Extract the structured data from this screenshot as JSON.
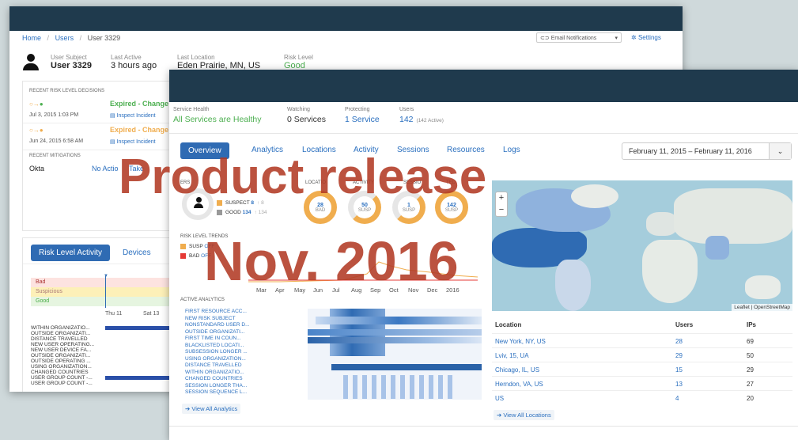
{
  "back": {
    "breadcrumb": [
      "Home",
      "/",
      "Users",
      "/",
      "User 3329"
    ],
    "email_notifications": "Email Notifications",
    "settings": "Settings",
    "summary": [
      {
        "label": "User Subject",
        "value": "User 3329"
      },
      {
        "label": "Last Active",
        "value": "3 hours ago"
      },
      {
        "label": "Last Location",
        "value": "Eden Prairie, MN, US"
      },
      {
        "label": "Risk Level",
        "value": "Good"
      }
    ],
    "recent_risk_title": "RECENT RISK LEVEL DECISIONS",
    "decisions": [
      {
        "date": "Jul 3, 2015 1:03 PM",
        "status": "Expired - Change",
        "link": "Inspect Incident",
        "color": "#4caf50"
      },
      {
        "date": "Jun 24, 2015 6:58 AM",
        "status": "Expired - Change",
        "link": "Inspect Incident",
        "color": "#f0ad4e"
      }
    ],
    "mitigations_title": "RECENT MITIGATIONS",
    "mitigation": {
      "source": "Okta",
      "action": "No Actio",
      "extra": "Take"
    },
    "tabs": {
      "active": "Risk Level Activity",
      "other": "Devices"
    },
    "levels": [
      "Bad",
      "Suspicious",
      "Good"
    ],
    "days": [
      "Thu 11",
      "Sat 13"
    ],
    "behaviors": [
      "WITHIN ORGANIZATIO...",
      "OUTSIDE ORGANIZATI...",
      "DISTANCE TRAVELLED",
      "NEW USER OPERATING...",
      "NEW USER DEVICE FA...",
      "OUTSIDE ORGANIZATI...",
      "OUTSIDE OPERATING ...",
      "USING ORGANIZATION...",
      "CHANGED COUNTRIES",
      "USER GROUP COUNT -...",
      "USER GROUP COUNT -..."
    ]
  },
  "front": {
    "stats": [
      {
        "label": "Service Health",
        "value": "All Services are Healthy",
        "color": "#4caf50"
      },
      {
        "label": "Watching",
        "value": "0 Services",
        "color": "#333333"
      },
      {
        "label": "Protecting",
        "value": "1 Service",
        "color": "#2a6fbf"
      },
      {
        "label": "Users",
        "value": "142",
        "extra": "(142 Active)",
        "color": "#2a6fbf"
      }
    ],
    "tabs": [
      "Overview",
      "Analytics",
      "Locations",
      "Activity",
      "Sessions",
      "Resources",
      "Logs"
    ],
    "date_range": "February 11, 2015 – February 11, 2016",
    "donut_headers": [
      "ERS",
      "LOCATIO",
      "ACTIVITY",
      "SESSIO",
      "TED"
    ],
    "legend": [
      {
        "label": "SUSPECT",
        "value": "8",
        "trend": "8",
        "color": "#f0ad4e"
      },
      {
        "label": "GOOD",
        "value": "134",
        "trend": "134",
        "color": "#999999"
      }
    ],
    "donuts": [
      {
        "value": "28",
        "label": "BAD"
      },
      {
        "value": "50",
        "label": "SUSP"
      },
      {
        "value": "1",
        "label": "SUSP"
      },
      {
        "value": "142",
        "label": "SUSP"
      }
    ],
    "trends_title": "RISK LEVEL TRENDS",
    "trend_legend": [
      {
        "label": "SUSP",
        "state": "OFF",
        "color": "#f0ad4e"
      },
      {
        "label": "BAD",
        "state": "OFF",
        "color": "#e53935"
      }
    ],
    "months": [
      "Mar",
      "Apr",
      "May",
      "Jun",
      "Jul",
      "Aug",
      "Sep",
      "Oct",
      "Nov",
      "Dec",
      "2016"
    ],
    "active_analytics_title": "ACTIVE ANALYTICS",
    "analytics": [
      "FIRST RESOURCE ACC...",
      "NEW RISK SUBJECT",
      "NONSTANDARD USER D...",
      "OUTSIDE ORGANIZATI...",
      "FIRST TIME IN COUN...",
      "BLACKLISTED LOCATI...",
      "SUBSESSION LONGER ...",
      "USING ORGANIZATION...",
      "DISTANCE TRAVELLED",
      "WITHIN ORGANIZATIO...",
      "CHANGED COUNTRIES",
      "SESSION LONGER THA...",
      "SESSION SEQUENCE L..."
    ],
    "view_all_analytics": "View All Analytics",
    "map_attribution": "Leaflet | OpenStreetMap",
    "table_headers": [
      "Location",
      "Users",
      "IPs"
    ],
    "locations": [
      {
        "name": "New York, NY, US",
        "users": "28",
        "ips": "69"
      },
      {
        "name": "Lviv, 15, UA",
        "users": "29",
        "ips": "50"
      },
      {
        "name": "Chicago, IL, US",
        "users": "15",
        "ips": "29"
      },
      {
        "name": "Herndon, VA, US",
        "users": "13",
        "ips": "27"
      },
      {
        "name": "US",
        "users": "4",
        "ips": "20"
      }
    ],
    "view_all_locations": "View All Locations"
  },
  "overlay": {
    "line1": "Product release",
    "line2": "Nov. 2016"
  }
}
